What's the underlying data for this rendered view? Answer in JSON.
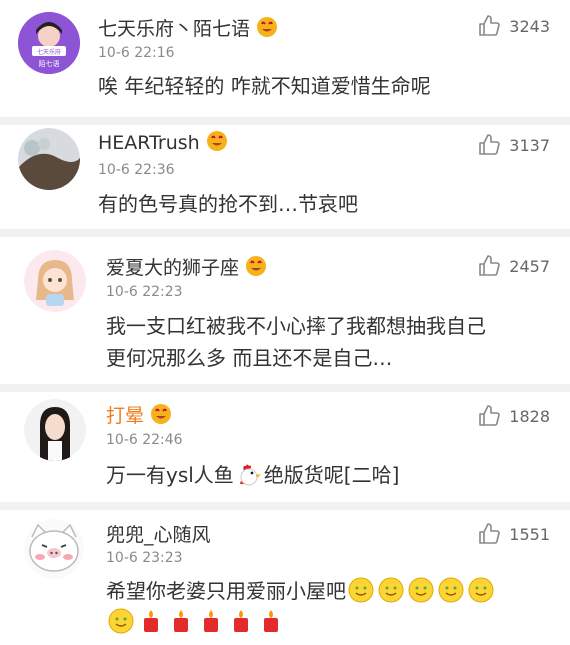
{
  "comments": [
    {
      "username": "七天乐府丶陌七语",
      "time": "10-6 22:16",
      "text": "唉 年纪轻轻的 咋就不知道爱惜生命呢",
      "likes": "3243",
      "avatar_text_top": "七天乐府",
      "avatar_text_bottom": "陌七语"
    },
    {
      "username": "HEARTrush",
      "time": "10-6 22:36",
      "text": "有的色号真的抢不到…节哀吧",
      "likes": "3137"
    },
    {
      "username": "爱夏大的狮子座",
      "time": "10-6 22:23",
      "text_line1": "我一支口红被我不小心摔了我都想抽我自己",
      "text_line2": "更何况那么多 而且还不是自己…",
      "likes": "2457"
    },
    {
      "username": "打晕",
      "time": "10-6 22:46",
      "text_before": "万一有ysl人鱼",
      "text_after": "绝版货呢[二哈]",
      "likes": "1828"
    },
    {
      "username": "兜兜_心随风",
      "time": "10-6 23:23",
      "text": "希望你老婆只用爱丽小屋吧",
      "likes": "1551"
    }
  ],
  "colors": {
    "username_orange": "#f07c1e",
    "divider": "#f1f1f1",
    "vip_badge": "#f6b21b"
  }
}
